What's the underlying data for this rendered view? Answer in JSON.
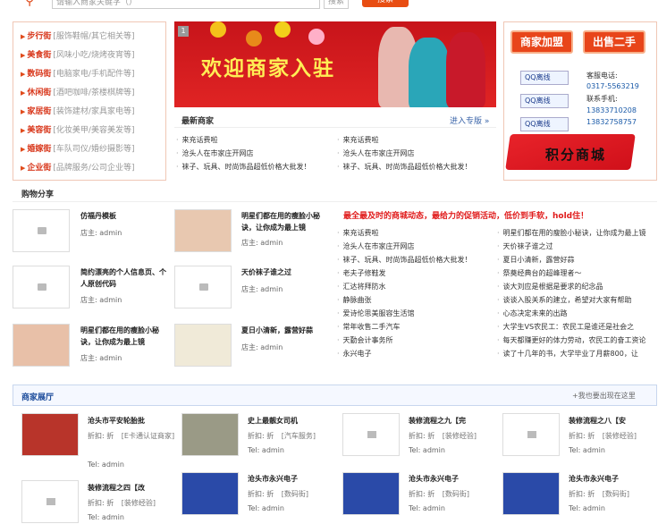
{
  "search": {
    "placeholder": "请输入商家关键字（）",
    "button": "搜索",
    "go": "搜索"
  },
  "categories": [
    {
      "name": "步行街",
      "sub": "[服饰鞋帽/其它相关等]"
    },
    {
      "name": "美食街",
      "sub": "[风味小吃/烧烤夜宵等]"
    },
    {
      "name": "数码街",
      "sub": "[电脑家电/手机配件等]"
    },
    {
      "name": "休闲街",
      "sub": "[酒吧咖啡/茶楼棋牌等]"
    },
    {
      "name": "家居街",
      "sub": "[装饰建材/家具家电等]"
    },
    {
      "name": "美容街",
      "sub": "[化妆美甲/美容美发等]"
    },
    {
      "name": "婚嫁街",
      "sub": "[车队司仪/婚纱摄影等]"
    },
    {
      "name": "企业街",
      "sub": "[品牌服务/公司企业等]"
    }
  ],
  "banner": {
    "index": "1",
    "text": "欢迎商家入驻"
  },
  "new_merchants": {
    "title": "最新商家",
    "more": "进入专版 »",
    "items": [
      "来充话费啦",
      "来充话费啦",
      "沧头人在市家庄开网店",
      "沧头人在市家庄开网店",
      "袜子、玩具、时尚饰品超低价格大批发！",
      "袜子、玩具、时尚饰品超低价格大批发！"
    ]
  },
  "right": {
    "join_button": "商家加盟",
    "sell_button": "出售二手",
    "qq_label": "QQ离线",
    "hotline_label": "客服电话:",
    "hotline": "0317-5563219",
    "mobile_label": "联系手机:",
    "mobile1": "13833710208",
    "mobile2": "13832758757",
    "points_mall": "积分商城"
  },
  "share": {
    "title": "购物分享",
    "items": [
      {
        "title": "仿福丹模板",
        "by": "店主: admin"
      },
      {
        "title": "明星们都在用的瘦脸小秘诀，让你成为最上镜",
        "by": "店主: admin"
      },
      {
        "title": "简约漂亮的个人信息页、个人原创代码",
        "by": "店主: admin"
      },
      {
        "title": "天价袜子谁之过",
        "by": "店主: admin"
      },
      {
        "title": "明星们都在用的瘦脸小秘诀，让你成为最上镜",
        "by": "店主: admin"
      },
      {
        "title": "夏日小清新，露营好蒜",
        "by": "店主: admin"
      }
    ]
  },
  "news": {
    "headline": "最全最及时的商城动态，最给力的促销活动，低价到手软，hold住！",
    "left": [
      "来充话费啦",
      "沧头人在市家庄开网店",
      "袜子、玩具、时尚饰品超低价格大批发！",
      "老夫子修鞋发",
      "汇达将拜防水",
      "静脉曲张",
      "爱诗伦思美服容生活馆",
      "常年收售二手汽车",
      "天勤会计事务所",
      "永兴电子"
    ],
    "right": [
      "明星们都在用的瘦脸小秘诀，让你成为最上镜",
      "天价袜子谁之过",
      "夏日小清新，露营好蒜",
      "祭奠经典台的超峰理者～",
      "谈大刘应是根据是要求的纪念品",
      "谈谈入股关系的建立，希望对大家有帮助",
      "心态决定未来的出路",
      "大学生VS农民工：农民工是谁还是社会之",
      "每天都赚更好的体力劳动，农民工的奋工资论",
      "读了十几年的书，大学毕业了月薪800，让"
    ]
  },
  "shops": {
    "title": "商家展厅",
    "add": "+我也要出现在这里",
    "items": [
      {
        "name": "沧头市平安轮胎批",
        "disc": "折扣: 折",
        "tag": "[E卡通认证商家]",
        "tel": "Tel: admin"
      },
      {
        "name": "史上最靓女司机",
        "disc": "折扣: 折",
        "tag": "[汽车服务]",
        "tel": "Tel: admin"
      },
      {
        "name": "装修流程之九【完",
        "disc": "折扣: 折",
        "tag": "[装修经验]",
        "tel": "Tel: admin"
      },
      {
        "name": "装修流程之八【安",
        "disc": "折扣: 折",
        "tag": "[装修经验]",
        "tel": "Tel: admin"
      },
      {
        "name": "装修流程之四【改",
        "disc": "折扣: 折",
        "tag": "[装修经验]",
        "tel": "Tel: admin"
      },
      {
        "name": "沧头市永兴电子",
        "disc": "折扣: 折",
        "tag": "[数码街]",
        "tel": "Tel: admin"
      },
      {
        "name": "沧头市永兴电子",
        "disc": "折扣: 折",
        "tag": "[数码街]",
        "tel": "Tel: admin"
      },
      {
        "name": "沧头市永兴电子",
        "disc": "折扣: 折",
        "tag": "[数码街]",
        "tel": "Tel: admin"
      }
    ]
  }
}
